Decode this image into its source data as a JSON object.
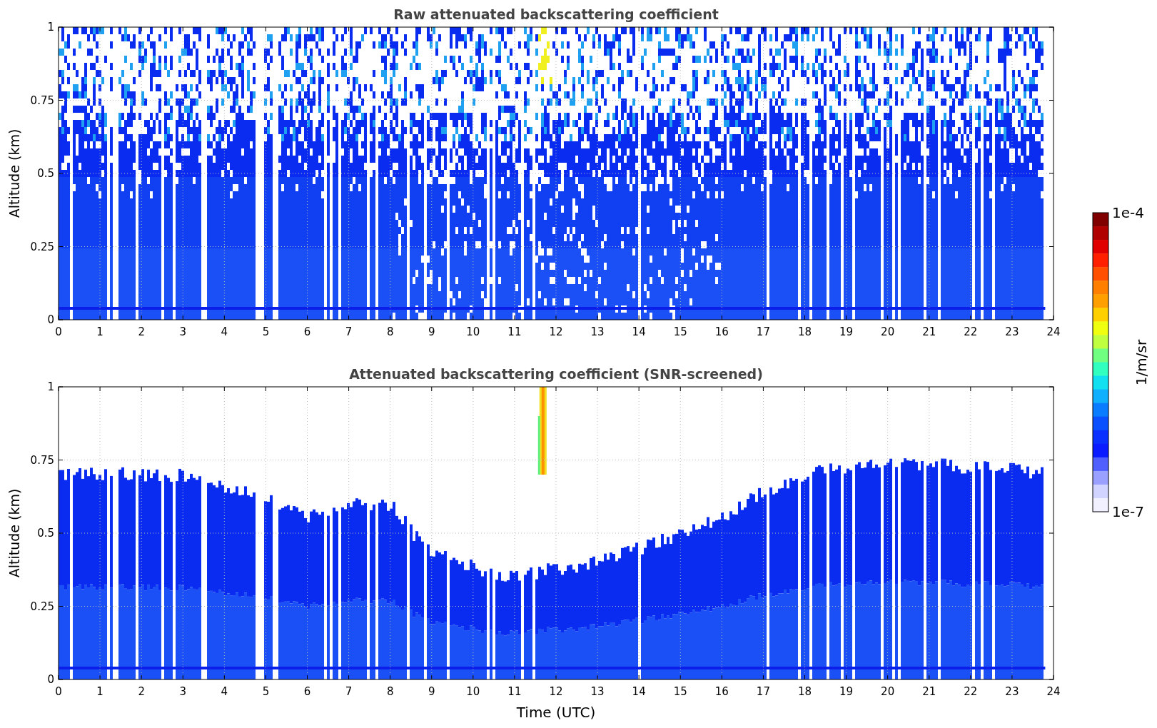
{
  "panels": [
    {
      "kind": "raw",
      "title": "Raw attenuated backscattering coefficient",
      "ylabel": "Altitude (km)",
      "yticks": [
        "1",
        "0.75",
        "0.5",
        "0.25",
        "0"
      ],
      "xticks": [
        "0",
        "1",
        "2",
        "3",
        "4",
        "5",
        "6",
        "7",
        "8",
        "9",
        "10",
        "11",
        "12",
        "13",
        "14",
        "15",
        "16",
        "17",
        "18",
        "19",
        "20",
        "21",
        "22",
        "23",
        "24"
      ]
    },
    {
      "kind": "screened",
      "title": "Attenuated backscattering coefficient (SNR-screened)",
      "ylabel": "Altitude (km)",
      "yticks": [
        "1",
        "0.75",
        "0.5",
        "0.25",
        "0"
      ],
      "xticks": [
        "0",
        "1",
        "2",
        "3",
        "4",
        "5",
        "6",
        "7",
        "8",
        "9",
        "10",
        "11",
        "12",
        "13",
        "14",
        "15",
        "16",
        "17",
        "18",
        "19",
        "20",
        "21",
        "22",
        "23",
        "24"
      ]
    }
  ],
  "xlabel": "Time (UTC)",
  "colorbar": {
    "max_label": "1e-4",
    "min_label": "1e-7",
    "label": "1/m/sr"
  }
}
